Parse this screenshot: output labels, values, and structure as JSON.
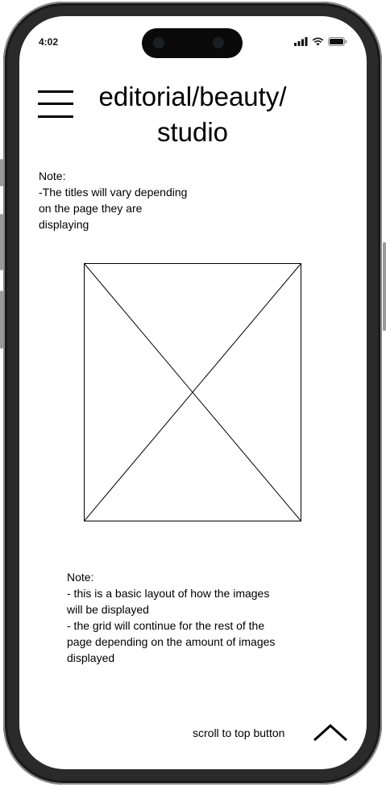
{
  "status_bar": {
    "time": "4:02",
    "icons": [
      "signal-icon",
      "wifi-icon",
      "battery-icon"
    ]
  },
  "header": {
    "menu_icon": "hamburger-menu-icon",
    "title_lines": [
      "editorial/beauty/",
      "studio"
    ]
  },
  "note_title": {
    "lines": [
      "Note:",
      "-The titles will vary depending",
      "on the page they are",
      "displaying"
    ]
  },
  "image_placeholder": {
    "icon": "image-placeholder-icon"
  },
  "note_grid": {
    "lines": [
      "Note:",
      "- this is a basic layout of how the images",
      "will be displayed",
      "- the grid will continue for the rest of the",
      "page depending on the amount of images",
      "displayed"
    ]
  },
  "footer": {
    "scroll_label": "scroll to top button",
    "scroll_icon": "chevron-up-icon"
  },
  "colors": {
    "frame": "#2a2a2a",
    "screen": "#ffffff",
    "text": "#000000"
  }
}
